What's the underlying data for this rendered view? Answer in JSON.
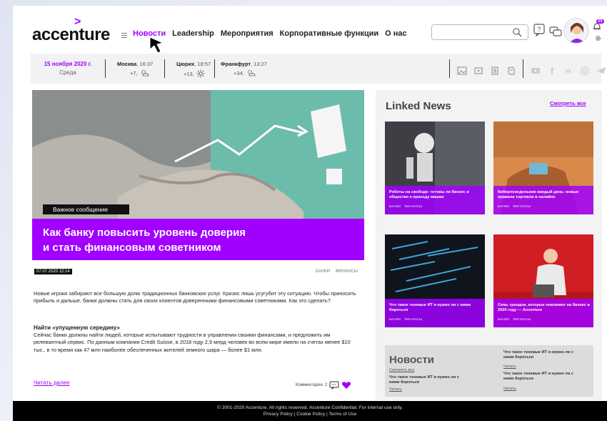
{
  "header": {
    "logo": "accenture",
    "nav": [
      "Новости",
      "Leadership",
      "Мероприятия",
      "Корпоративные функции",
      "О нас"
    ],
    "active_nav": 0,
    "search_placeholder": "",
    "notification_count": "25"
  },
  "infobar": {
    "date": "15 ноября 2020 г.",
    "weekday": "Среда",
    "cities": [
      {
        "name": "Москва",
        "time": "16:37",
        "temp": "+7,"
      },
      {
        "name": "Цюрих",
        "time": "18:57",
        "temp": "+13,"
      },
      {
        "name": "Франкфурт",
        "time": "13:27",
        "temp": "+34,"
      }
    ]
  },
  "article": {
    "badge": "Важное сообщение",
    "headline_1": "Как банку повысить уровень доверия",
    "headline_2": "и стать финансовым советником",
    "timestamp": "07.07.2020 12:14",
    "tags": "БАНКИ ФИНАНСЫ",
    "lead": "Новые игроки забирают все большую долю традиционных банковских услуг. Кризис лишь усугубит эту ситуацию. Чтобы приносить прибыль и дальше, банки должны стать для своих клиентов доверенными финансовыми советниками. Как это сделать?",
    "subhead": "Найти «упущенную середину»",
    "body": "Сейчас банки должны найти людей, которые испытывают трудности в управлении своими финансами, и предложить им релевантный сервис. По данным компании Credit Suisse, в 2018 году 2,9 млрд человек во всем мире имели на счетах менее $10 тыс., в то время как 47 млн наиболее обеспеченных жителей земного шара — более $1 млн.",
    "read_more": "Читать далее",
    "comments_label": "Комментарии",
    "comments_count": "2"
  },
  "linked_news": {
    "title": "Linked News",
    "see_all": "Смотреть все",
    "cards": [
      {
        "title": "Роботы на свободе: готовы ли бизнес и общество к приходу машин",
        "tags": "БАНКИ ФИНАНСЫ"
      },
      {
        "title": "Киберпонедельник каждый день: новые правила торговли в онлайне",
        "tags": "БАНКИ ФИНАНСЫ"
      },
      {
        "title": "Что такое теневые ИТ и нужно ли с ними бороться",
        "tags": "БАНКИ ФИНАНСЫ"
      },
      {
        "title": "Семь трендов, которые повлияют на бизнес в 2020 году — Accenture",
        "tags": "БАНКИ ФИНАНСЫ"
      }
    ]
  },
  "news": {
    "title": "Новости",
    "see_all": "Смотреть все",
    "items": [
      {
        "title": "Что такое теневые ИТ и нужно ли с ними бороться",
        "link": "Читать"
      },
      {
        "title": "Что такое теневые ИТ и нужно ли с ними бороться",
        "link": "Читать"
      },
      {
        "title": "Что такое теневые ИТ и нужно ли с ними бороться",
        "link": "Читать"
      }
    ]
  },
  "footer": {
    "line1": "© 2001-2020 Accenture. All rights reserved. Accenture Confidential. For internal use only.",
    "line2": "Privacy Policy | Cookie Policy | Terms of Use"
  },
  "colors": {
    "accent": "#a100ff",
    "footer": "#000000"
  }
}
